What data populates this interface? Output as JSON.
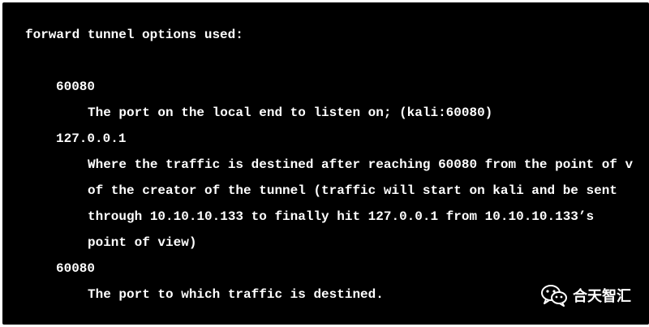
{
  "terminal": {
    "heading": "forward tunnel options used:",
    "lines": [
      "60080",
      "The port on the local end to listen on; (kali:60080)",
      "127.0.0.1",
      "Where the traffic is destined after reaching 60080 from the point of v",
      "of the creator of the tunnel (traffic will start on kali and be sent",
      "through 10.10.10.133 to finally hit 127.0.0.1 from 10.10.10.133’s",
      "point of view)",
      "60080",
      "The port to which traffic is destined."
    ]
  },
  "watermark": {
    "icon": "wechat-icon",
    "label": "合天智汇"
  },
  "colors": {
    "background": "#000000",
    "text": "#ffffff",
    "page": "#ffffff"
  }
}
